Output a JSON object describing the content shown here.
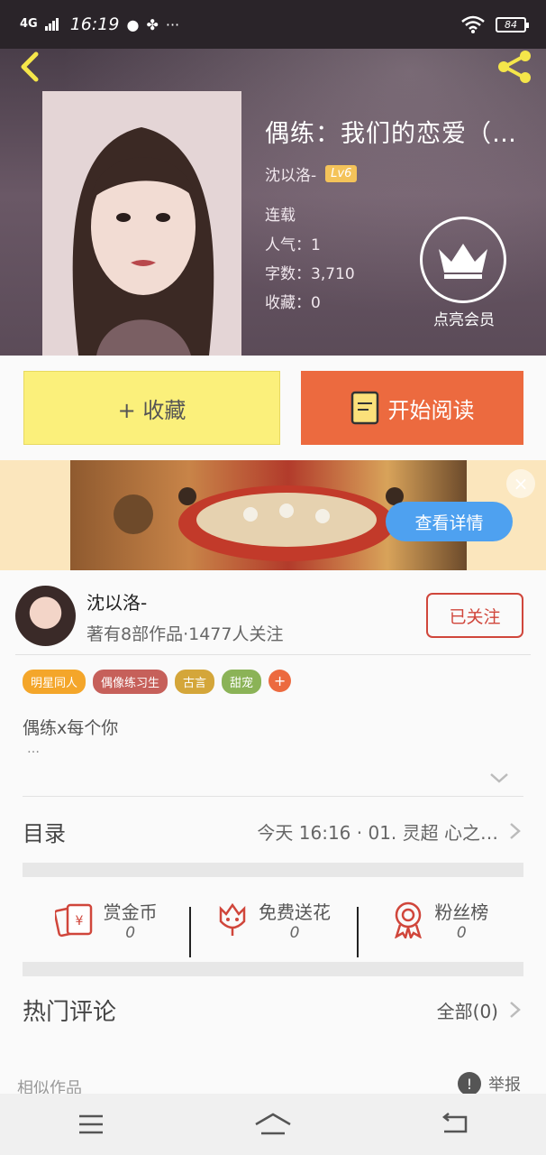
{
  "status_bar": {
    "network": "4G",
    "time": "16:19",
    "battery": "84",
    "more": "···"
  },
  "colors": {
    "accent_orange": "#ec6a3f",
    "fav_yellow": "#fbf07b",
    "follow_red": "#d0463b",
    "cta_blue": "#4ea1f0"
  },
  "book": {
    "title": "偶练：我们的恋爱（…",
    "author": "沈以洛-",
    "level": "Lv6",
    "status": "连载",
    "popularity": "人气：1",
    "word_count": "字数：3,710",
    "favorites": "收藏：0"
  },
  "vip": {
    "label": "点亮会员"
  },
  "actions": {
    "favorite": "+ 收藏",
    "read": "开始阅读"
  },
  "banner": {
    "cta": "查看详情",
    "close": "×"
  },
  "author_card": {
    "name": "沈以洛-",
    "stats": "著有8部作品·1477人关注",
    "follow": "已关注"
  },
  "tags": [
    {
      "label": "明星同人",
      "color": "#f4a62a"
    },
    {
      "label": "偶像练习生",
      "color": "#c6605a"
    },
    {
      "label": "古言",
      "color": "#d4a63a"
    },
    {
      "label": "甜宠",
      "color": "#8bb357"
    }
  ],
  "tag_add": "+",
  "description": {
    "text": "偶练x每个你",
    "ellipsis": "…"
  },
  "toc": {
    "label": "目录",
    "latest": "今天 16:16 · 01. 灵超 心之…"
  },
  "rewards": [
    {
      "label": "赏金币",
      "count": "0",
      "icon": "red-envelope-icon"
    },
    {
      "label": "免费送花",
      "count": "0",
      "icon": "flower-icon"
    },
    {
      "label": "粉丝榜",
      "count": "0",
      "icon": "medal-icon"
    }
  ],
  "comments": {
    "title": "热门评论",
    "all": "全部(0)"
  },
  "similar": {
    "label": "相似作品"
  },
  "report": {
    "label": "举报",
    "icon": "!"
  }
}
